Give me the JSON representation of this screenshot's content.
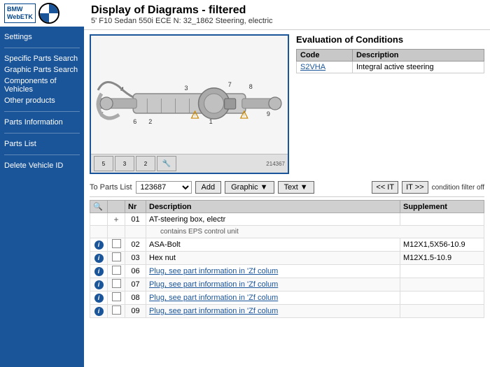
{
  "sidebar": {
    "logo_text": "BMWWebETK",
    "nav_items": [
      {
        "id": "settings",
        "label": "Settings"
      },
      {
        "id": "specific-parts",
        "label": "Specific Parts Search"
      },
      {
        "id": "graphic-parts",
        "label": "Graphic Parts Search"
      },
      {
        "id": "components",
        "label": "Components of Vehicles"
      },
      {
        "id": "other-products",
        "label": "Other products"
      },
      {
        "id": "parts-information",
        "label": "Parts Information"
      },
      {
        "id": "parts-list",
        "label": "Parts List"
      },
      {
        "id": "delete-vehicle",
        "label": "Delete Vehicle ID"
      }
    ]
  },
  "header": {
    "title": "Display of Diagrams - filtered",
    "subtitle": "5' F10 Sedan 550i ECE N: 32_1862 Steering, electric"
  },
  "evaluation": {
    "title": "Evaluation of Conditions",
    "table_headers": [
      "Code",
      "Description"
    ],
    "rows": [
      {
        "code": "S2VHA",
        "description": "Integral active steering"
      }
    ]
  },
  "toolbar": {
    "to_parts_list_label": "To Parts List",
    "parts_list_value": "123687",
    "add_btn": "Add",
    "graphic_btn": "Graphic ▼",
    "text_btn": "Text ▼",
    "nav_left": "<< IT",
    "nav_right": "IT >>",
    "condition_label": "condition filter off"
  },
  "parts_table": {
    "headers": [
      "",
      "",
      "Nr",
      "Description",
      "Supplement"
    ],
    "rows": [
      {
        "has_info": false,
        "has_check": false,
        "has_plus": true,
        "nr": "01",
        "description": "AT-steering box, electr",
        "supplement": "",
        "sub": true,
        "sub_text": "contains EPS control unit"
      },
      {
        "has_info": true,
        "has_check": true,
        "nr": "02",
        "description": "ASA-Bolt",
        "supplement": "M12X1,5X56-10.9"
      },
      {
        "has_info": true,
        "has_check": true,
        "nr": "03",
        "description": "Hex nut",
        "supplement": "M12X1.5-10.9"
      },
      {
        "has_info": true,
        "has_check": true,
        "nr": "06",
        "description": "Plug, see part information in 'Zf colum",
        "supplement": ""
      },
      {
        "has_info": true,
        "has_check": true,
        "nr": "07",
        "description": "Plug, see part information in 'Zf colum",
        "supplement": ""
      },
      {
        "has_info": true,
        "has_check": true,
        "nr": "08",
        "description": "Plug, see part information in 'Zf colum",
        "supplement": ""
      },
      {
        "has_info": true,
        "has_check": true,
        "nr": "09",
        "description": "Plug, see part information in 'Zf colum",
        "supplement": ""
      }
    ]
  },
  "diagram": {
    "thumbnails": [
      "5",
      "3",
      "2",
      "🔧"
    ],
    "diagram_id": "214367"
  }
}
